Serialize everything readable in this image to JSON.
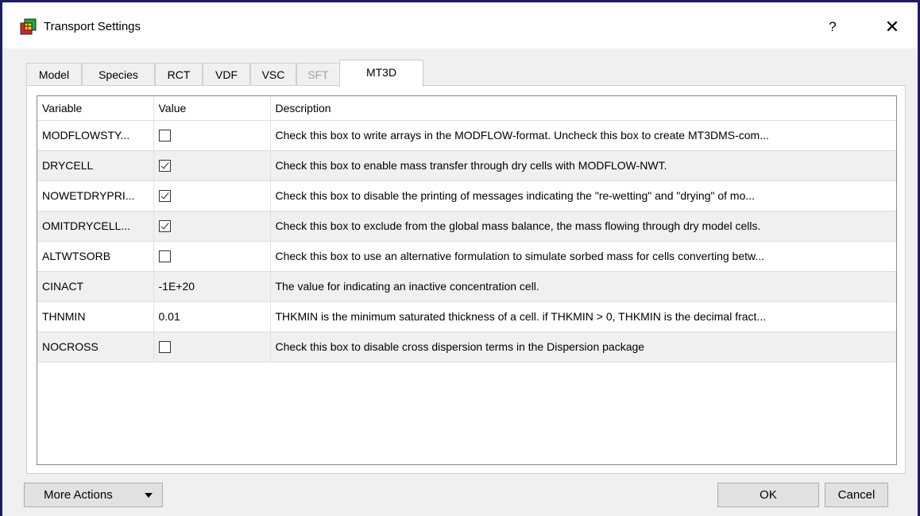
{
  "window": {
    "title": "Transport Settings",
    "help_label": "?",
    "close_label": "✕"
  },
  "tabs": [
    {
      "label": "Model",
      "state": "normal"
    },
    {
      "label": "Species",
      "state": "normal"
    },
    {
      "label": "RCT",
      "state": "normal"
    },
    {
      "label": "VDF",
      "state": "normal"
    },
    {
      "label": "VSC",
      "state": "normal"
    },
    {
      "label": "SFT",
      "state": "disabled"
    },
    {
      "label": "MT3D",
      "state": "active"
    }
  ],
  "grid": {
    "headers": [
      "Variable",
      "Value",
      "Description"
    ],
    "rows": [
      {
        "variable": "MODFLOWSTY...",
        "type": "checkbox",
        "checked": false,
        "value": "",
        "description": "Check this box to write arrays in the MODFLOW-format. Uncheck this box to create MT3DMS-com..."
      },
      {
        "variable": "DRYCELL",
        "type": "checkbox",
        "checked": true,
        "value": "",
        "description": "Check this box to enable mass transfer through dry cells with MODFLOW-NWT."
      },
      {
        "variable": "NOWETDRYPRI...",
        "type": "checkbox",
        "checked": true,
        "value": "",
        "description": "Check this box to disable the printing of messages indicating the \"re-wetting\" and \"drying\" of mo..."
      },
      {
        "variable": "OMITDRYCELL...",
        "type": "checkbox",
        "checked": true,
        "value": "",
        "description": "Check this box to exclude from the global mass balance, the mass flowing through dry model cells."
      },
      {
        "variable": "ALTWTSORB",
        "type": "checkbox",
        "checked": false,
        "value": "",
        "description": "Check this box to use an alternative formulation to simulate sorbed mass for cells converting betw..."
      },
      {
        "variable": "CINACT",
        "type": "text",
        "checked": false,
        "value": "-1E+20",
        "description": "The value for indicating an inactive concentration cell."
      },
      {
        "variable": "THNMIN",
        "type": "text",
        "checked": false,
        "value": "0.01",
        "description": "THKMIN is the minimum saturated thickness of a cell. if THKMIN > 0, THKMIN is the decimal fract..."
      },
      {
        "variable": "NOCROSS",
        "type": "checkbox",
        "checked": false,
        "value": "",
        "description": "Check this box to disable cross dispersion terms in the Dispersion package"
      }
    ]
  },
  "footer": {
    "more_actions_label": "More Actions",
    "ok_label": "OK",
    "cancel_label": "Cancel"
  }
}
